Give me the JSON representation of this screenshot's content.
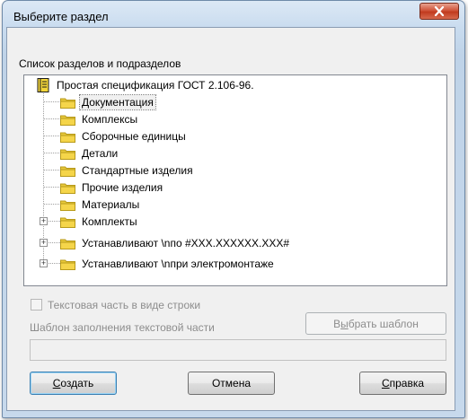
{
  "window": {
    "title": "Выберите раздел"
  },
  "tree": {
    "label": "Список разделов и подразделов",
    "root": "Простая спецификация ГОСТ 2.106-96.",
    "items": [
      {
        "label": "Документация",
        "selected": true,
        "expandable": false
      },
      {
        "label": "Комплексы",
        "selected": false,
        "expandable": false
      },
      {
        "label": "Сборочные единицы",
        "selected": false,
        "expandable": false
      },
      {
        "label": "Детали",
        "selected": false,
        "expandable": false
      },
      {
        "label": "Стандартные изделия",
        "selected": false,
        "expandable": false
      },
      {
        "label": "Прочие изделия",
        "selected": false,
        "expandable": false
      },
      {
        "label": "Материалы",
        "selected": false,
        "expandable": false
      },
      {
        "label": "Комплекты",
        "selected": false,
        "expandable": true
      },
      {
        "label": "Устанавливают \\nпо #XXX.XXXXXX.XXX#",
        "selected": false,
        "expandable": true
      },
      {
        "label": "Устанавливают \\nпри электромонтаже",
        "selected": false,
        "expandable": true
      }
    ]
  },
  "options": {
    "text_as_line_label": "Текстовая часть в виде строки",
    "text_as_line_checked": false,
    "template_label": "Шаблон заполнения текстовой части",
    "template_value": "",
    "choose_template_pre": "В",
    "choose_template_acc": "ы",
    "choose_template_post": "брать шаблон"
  },
  "buttons": {
    "create_acc": "С",
    "create_post": "оздать",
    "cancel": "Отмена",
    "help_acc": "С",
    "help_post": "правка"
  },
  "colors": {
    "folder": "#f3d53a",
    "folder_edge": "#b89a1a",
    "close_button": "#c9452a"
  },
  "icons": {
    "close": "close-x-icon",
    "folder": "folder-icon",
    "root": "book-icon",
    "expander": "plus-expander-icon"
  }
}
